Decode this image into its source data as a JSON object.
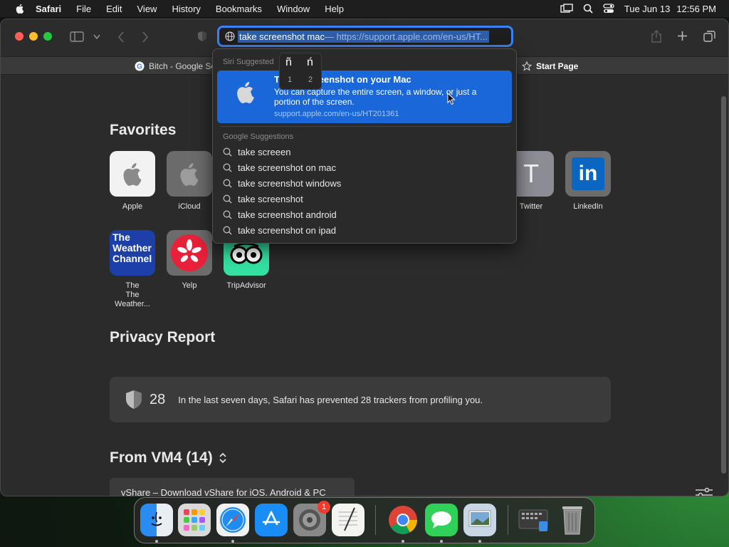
{
  "menubar": {
    "app_name": "Safari",
    "items": [
      "File",
      "Edit",
      "View",
      "History",
      "Bookmarks",
      "Window",
      "Help"
    ],
    "date": "Tue Jun 13",
    "time": "12:56 PM"
  },
  "urlbar": {
    "typed": "take screenshot mac",
    "completion": " — https://support.apple.com/en-us/HT..."
  },
  "tabs": [
    {
      "label": "Bitch - Google Se"
    },
    {
      "label": "Start Page"
    }
  ],
  "dropdown": {
    "siri_header": "Siri Suggested",
    "top_hit": {
      "title": "Take a screenshot on your Mac",
      "description": "You can capture the entire screen, a window, or just a portion of the screen.",
      "url": "support.apple.com/en-us/HT201361"
    },
    "google_header": "Google Suggestions",
    "suggestions": [
      "take screeen",
      "take screenshot on mac",
      "take screenshot windows",
      "take screenshot",
      "take screenshot android",
      "take screenshot on ipad"
    ],
    "accent_popup": {
      "char1": "ñ",
      "char2": "ń",
      "num1": "1",
      "num2": "2"
    }
  },
  "favorites": {
    "title": "Favorites",
    "items": [
      {
        "label": "Apple"
      },
      {
        "label": "iCloud"
      },
      {
        "label": "Twitter",
        "glyph": "T"
      },
      {
        "label": "LinkedIn",
        "glyph": "in"
      },
      {
        "label": "The Weather...",
        "line1": "The",
        "glyph": "The Weather Channel"
      },
      {
        "label": "Yelp"
      },
      {
        "label": "TripAdvisor"
      }
    ]
  },
  "privacy": {
    "title": "Privacy Report",
    "count": "28",
    "text": "In the last seven days, Safari has prevented 28 trackers from profiling you."
  },
  "from_device": {
    "title": "From VM4 (14)",
    "item": "vShare – Download vShare for iOS, Android & PC"
  },
  "dock": {
    "settings_badge": "1"
  },
  "colors": {
    "accent": "#1a67d9",
    "url_focus": "#3a82f7",
    "close": "#ff5f57",
    "minimize": "#febc2e",
    "maximize": "#28c840"
  }
}
